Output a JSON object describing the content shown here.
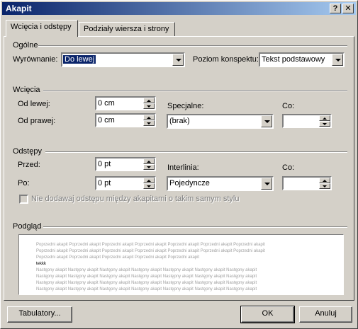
{
  "window": {
    "title": "Akapit",
    "help_label": "?",
    "close_label": "✕"
  },
  "tabs": [
    {
      "label": "Wcięcia i odstępy",
      "active": true
    },
    {
      "label": "Podziały wiersza i strony",
      "active": false
    }
  ],
  "general": {
    "section_title": "Ogólne",
    "alignment_label": "Wyrównanie:",
    "alignment_value": "Do lewej",
    "outline_label": "Poziom konspektu:",
    "outline_value": "Tekst podstawowy"
  },
  "indentation": {
    "section_title": "Wcięcia",
    "left_label": "Od lewej:",
    "left_value": "0 cm",
    "right_label": "Od prawej:",
    "right_value": "0 cm",
    "special_label": "Specjalne:",
    "special_value": "(brak)",
    "by_label": "Co:",
    "by_value": ""
  },
  "spacing": {
    "section_title": "Odstępy",
    "before_label": "Przed:",
    "before_value": "0 pt",
    "after_label": "Po:",
    "after_value": "0 pt",
    "line_spacing_label": "Interlinia:",
    "line_spacing_value": "Pojedyncze",
    "at_label": "Co:",
    "at_value": "",
    "no_space_checkbox_label": "Nie dodawaj odstępu między akapitami o takim samym stylu",
    "no_space_checked": false
  },
  "preview": {
    "section_title": "Podgląd",
    "previous_lines": [
      "Poprzedni akapit Poprzedni akapit Poprzedni akapit Poprzedni akapit Poprzedni akapit Poprzedni akapit Poprzedni akapit",
      "Poprzedni akapit Poprzedni akapit Poprzedni akapit Poprzedni akapit Poprzedni akapit Poprzedni akapit Poprzedni akapit",
      "Poprzedni akapit Poprzedni akapit Poprzedni akapit Poprzedni akapit Poprzedni akapit"
    ],
    "current_text": "tekkk",
    "next_lines": [
      "Następny akapit Następny akapit Następny akapit Następny akapit Następny akapit Następny akapit Następny akapit",
      "Następny akapit Następny akapit Następny akapit Następny akapit Następny akapit Następny akapit Następny akapit",
      "Następny akapit Następny akapit Następny akapit Następny akapit Następny akapit Następny akapit Następny akapit",
      "Następny akapit Następny akapit Następny akapit Następny akapit Następny akapit Następny akapit Następny akapit",
      "Następny akapit Następny akapit Następny akapit Następny akapit Następny akapit Następny akapit Następny akapit",
      "Następny akapit Następny akapit Następny akapit Następny akapit Następny akapit Następny akapit Następny akapit"
    ]
  },
  "buttons": {
    "tabs": "Tabulatory...",
    "ok": "OK",
    "cancel": "Anuluj"
  },
  "colors": {
    "face": "#d4d0c8",
    "title_from": "#0a246a",
    "title_to": "#a6caf0",
    "selection": "#0a246a"
  }
}
